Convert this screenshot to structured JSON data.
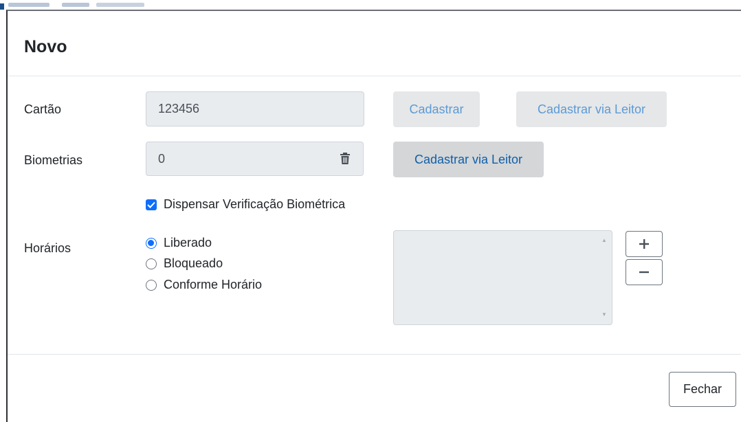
{
  "dialog": {
    "title": "Novo"
  },
  "cartao": {
    "label": "Cartão",
    "value": "123456",
    "register_button": "Cadastrar",
    "register_reader_button": "Cadastrar via Leitor"
  },
  "biometrias": {
    "label": "Biometrias",
    "value": "0",
    "delete_icon": "trash-icon",
    "register_reader_button": "Cadastrar via Leitor"
  },
  "dispensar": {
    "label": "Dispensar Verificação Biométrica",
    "checked": true
  },
  "horarios": {
    "label": "Horários",
    "options": [
      {
        "label": "Liberado",
        "selected": true
      },
      {
        "label": "Bloqueado",
        "selected": false
      },
      {
        "label": "Conforme Horário",
        "selected": false
      }
    ],
    "add_icon": "plus-icon",
    "remove_icon": "minus-icon"
  },
  "footer": {
    "close_button": "Fechar"
  },
  "colors": {
    "accent": "#0d6efd",
    "disabled_button_text": "#5b9ad6",
    "field_background": "#e9ecef"
  }
}
